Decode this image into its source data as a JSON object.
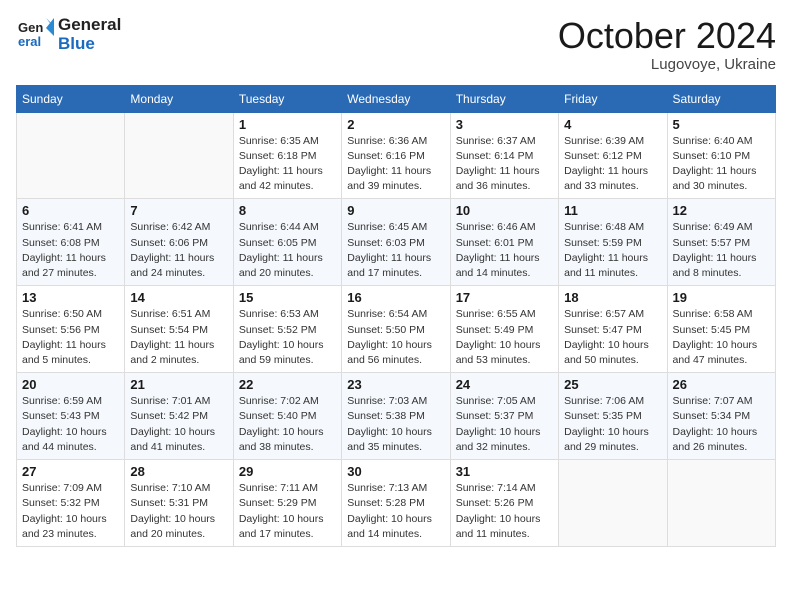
{
  "logo": {
    "text_general": "General",
    "text_blue": "Blue"
  },
  "header": {
    "month": "October 2024",
    "location": "Lugovoye, Ukraine"
  },
  "days_of_week": [
    "Sunday",
    "Monday",
    "Tuesday",
    "Wednesday",
    "Thursday",
    "Friday",
    "Saturday"
  ],
  "weeks": [
    [
      {
        "day": "",
        "detail": ""
      },
      {
        "day": "",
        "detail": ""
      },
      {
        "day": "1",
        "detail": "Sunrise: 6:35 AM\nSunset: 6:18 PM\nDaylight: 11 hours and 42 minutes."
      },
      {
        "day": "2",
        "detail": "Sunrise: 6:36 AM\nSunset: 6:16 PM\nDaylight: 11 hours and 39 minutes."
      },
      {
        "day": "3",
        "detail": "Sunrise: 6:37 AM\nSunset: 6:14 PM\nDaylight: 11 hours and 36 minutes."
      },
      {
        "day": "4",
        "detail": "Sunrise: 6:39 AM\nSunset: 6:12 PM\nDaylight: 11 hours and 33 minutes."
      },
      {
        "day": "5",
        "detail": "Sunrise: 6:40 AM\nSunset: 6:10 PM\nDaylight: 11 hours and 30 minutes."
      }
    ],
    [
      {
        "day": "6",
        "detail": "Sunrise: 6:41 AM\nSunset: 6:08 PM\nDaylight: 11 hours and 27 minutes."
      },
      {
        "day": "7",
        "detail": "Sunrise: 6:42 AM\nSunset: 6:06 PM\nDaylight: 11 hours and 24 minutes."
      },
      {
        "day": "8",
        "detail": "Sunrise: 6:44 AM\nSunset: 6:05 PM\nDaylight: 11 hours and 20 minutes."
      },
      {
        "day": "9",
        "detail": "Sunrise: 6:45 AM\nSunset: 6:03 PM\nDaylight: 11 hours and 17 minutes."
      },
      {
        "day": "10",
        "detail": "Sunrise: 6:46 AM\nSunset: 6:01 PM\nDaylight: 11 hours and 14 minutes."
      },
      {
        "day": "11",
        "detail": "Sunrise: 6:48 AM\nSunset: 5:59 PM\nDaylight: 11 hours and 11 minutes."
      },
      {
        "day": "12",
        "detail": "Sunrise: 6:49 AM\nSunset: 5:57 PM\nDaylight: 11 hours and 8 minutes."
      }
    ],
    [
      {
        "day": "13",
        "detail": "Sunrise: 6:50 AM\nSunset: 5:56 PM\nDaylight: 11 hours and 5 minutes."
      },
      {
        "day": "14",
        "detail": "Sunrise: 6:51 AM\nSunset: 5:54 PM\nDaylight: 11 hours and 2 minutes."
      },
      {
        "day": "15",
        "detail": "Sunrise: 6:53 AM\nSunset: 5:52 PM\nDaylight: 10 hours and 59 minutes."
      },
      {
        "day": "16",
        "detail": "Sunrise: 6:54 AM\nSunset: 5:50 PM\nDaylight: 10 hours and 56 minutes."
      },
      {
        "day": "17",
        "detail": "Sunrise: 6:55 AM\nSunset: 5:49 PM\nDaylight: 10 hours and 53 minutes."
      },
      {
        "day": "18",
        "detail": "Sunrise: 6:57 AM\nSunset: 5:47 PM\nDaylight: 10 hours and 50 minutes."
      },
      {
        "day": "19",
        "detail": "Sunrise: 6:58 AM\nSunset: 5:45 PM\nDaylight: 10 hours and 47 minutes."
      }
    ],
    [
      {
        "day": "20",
        "detail": "Sunrise: 6:59 AM\nSunset: 5:43 PM\nDaylight: 10 hours and 44 minutes."
      },
      {
        "day": "21",
        "detail": "Sunrise: 7:01 AM\nSunset: 5:42 PM\nDaylight: 10 hours and 41 minutes."
      },
      {
        "day": "22",
        "detail": "Sunrise: 7:02 AM\nSunset: 5:40 PM\nDaylight: 10 hours and 38 minutes."
      },
      {
        "day": "23",
        "detail": "Sunrise: 7:03 AM\nSunset: 5:38 PM\nDaylight: 10 hours and 35 minutes."
      },
      {
        "day": "24",
        "detail": "Sunrise: 7:05 AM\nSunset: 5:37 PM\nDaylight: 10 hours and 32 minutes."
      },
      {
        "day": "25",
        "detail": "Sunrise: 7:06 AM\nSunset: 5:35 PM\nDaylight: 10 hours and 29 minutes."
      },
      {
        "day": "26",
        "detail": "Sunrise: 7:07 AM\nSunset: 5:34 PM\nDaylight: 10 hours and 26 minutes."
      }
    ],
    [
      {
        "day": "27",
        "detail": "Sunrise: 7:09 AM\nSunset: 5:32 PM\nDaylight: 10 hours and 23 minutes."
      },
      {
        "day": "28",
        "detail": "Sunrise: 7:10 AM\nSunset: 5:31 PM\nDaylight: 10 hours and 20 minutes."
      },
      {
        "day": "29",
        "detail": "Sunrise: 7:11 AM\nSunset: 5:29 PM\nDaylight: 10 hours and 17 minutes."
      },
      {
        "day": "30",
        "detail": "Sunrise: 7:13 AM\nSunset: 5:28 PM\nDaylight: 10 hours and 14 minutes."
      },
      {
        "day": "31",
        "detail": "Sunrise: 7:14 AM\nSunset: 5:26 PM\nDaylight: 10 hours and 11 minutes."
      },
      {
        "day": "",
        "detail": ""
      },
      {
        "day": "",
        "detail": ""
      }
    ]
  ]
}
